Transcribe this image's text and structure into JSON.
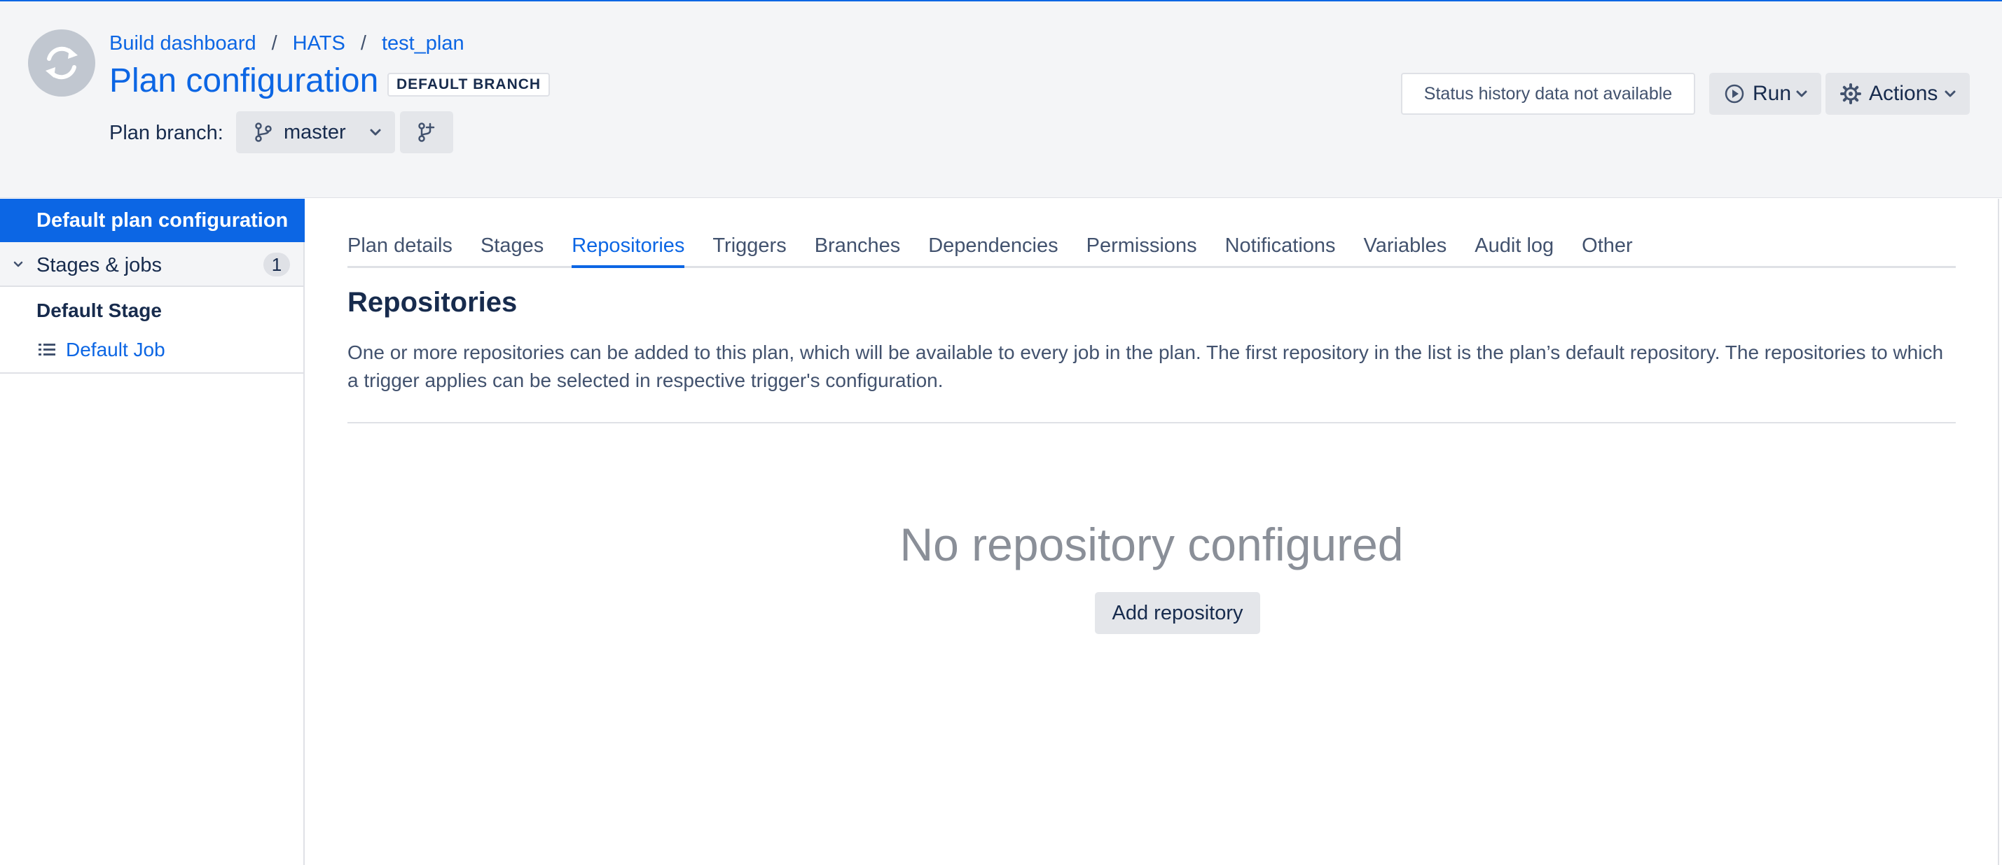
{
  "breadcrumb": {
    "items": [
      "Build dashboard",
      "HATS",
      "test_plan"
    ],
    "separator": "/"
  },
  "header": {
    "title": "Plan configuration",
    "branch_badge": "DEFAULT BRANCH",
    "branch_label": "Plan branch:",
    "branch_value": "master",
    "status_text": "Status history data not available",
    "run_label": "Run",
    "actions_label": "Actions"
  },
  "sidebar": {
    "selected_label": "Default plan configuration",
    "stages_label": "Stages & jobs",
    "stages_count": "1",
    "stage_name": "Default Stage",
    "job_name": "Default Job"
  },
  "tabs": [
    {
      "label": "Plan details",
      "active": false
    },
    {
      "label": "Stages",
      "active": false
    },
    {
      "label": "Repositories",
      "active": true
    },
    {
      "label": "Triggers",
      "active": false
    },
    {
      "label": "Branches",
      "active": false
    },
    {
      "label": "Dependencies",
      "active": false
    },
    {
      "label": "Permissions",
      "active": false
    },
    {
      "label": "Notifications",
      "active": false
    },
    {
      "label": "Variables",
      "active": false
    },
    {
      "label": "Audit log",
      "active": false
    },
    {
      "label": "Other",
      "active": false
    }
  ],
  "main": {
    "section_title": "Repositories",
    "description": "One or more repositories can be added to this plan, which will be available to every job in the plan. The first repository in the list is the plan’s default repository. The repositories to which a trigger applies can be selected in respective trigger's configuration.",
    "empty_title": "No repository configured",
    "add_button": "Add repository"
  },
  "icons": {
    "plan_avatar": "refresh-icon",
    "branch": "git-branch-icon",
    "create_branch": "git-branch-add-icon",
    "run": "play-circle-icon",
    "actions": "gear-icon",
    "job": "list-icon",
    "chevron": "chevron-down-icon"
  },
  "colors": {
    "accent": "#0c66e4",
    "header_bg": "#f4f5f7",
    "muted_text": "#8a8f98"
  }
}
